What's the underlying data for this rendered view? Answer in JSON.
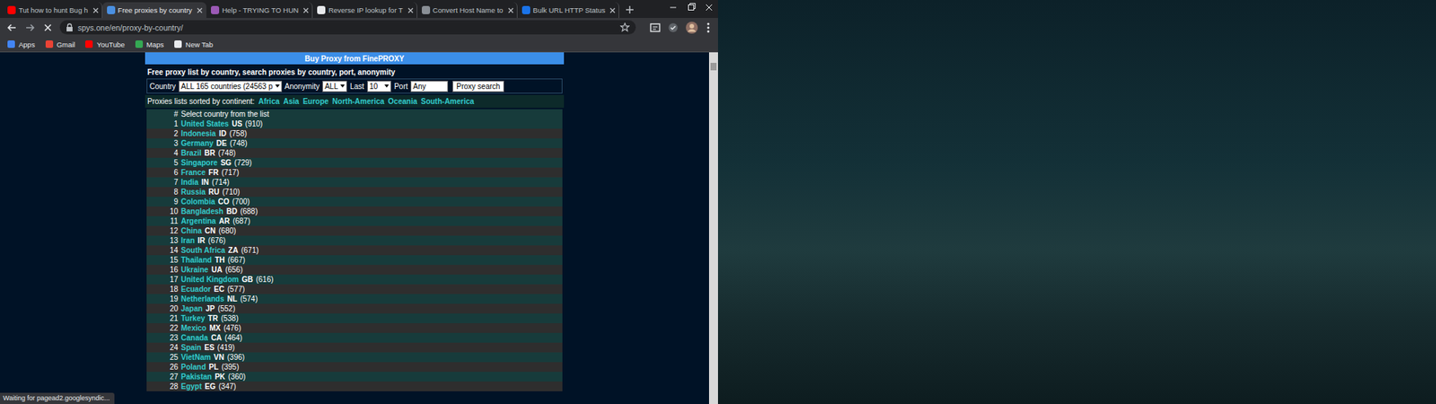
{
  "browser": {
    "tabs": [
      {
        "label": "Tut how to hunt Bug h",
        "selected": false,
        "color": "#ff0000"
      },
      {
        "label": "Free proxies by country",
        "selected": true,
        "color": "#4a90e2"
      },
      {
        "label": "Help - TRYING TO HUN",
        "selected": false,
        "color": "#9b59b6"
      },
      {
        "label": "Reverse IP lookup for T",
        "selected": false,
        "color": "#e8eaed"
      },
      {
        "label": "Convert Host Name to",
        "selected": false,
        "color": "#8a8f96"
      },
      {
        "label": "Bulk URL HTTP Status",
        "selected": false,
        "color": "#1a73e8"
      }
    ],
    "address_bar": {
      "url": "spys.one/en/proxy-by-country/"
    },
    "bookmarks": [
      {
        "label": "Apps",
        "color": "#4285f4"
      },
      {
        "label": "Gmail",
        "color": "#ea4335"
      },
      {
        "label": "YouTube",
        "color": "#ff0000"
      },
      {
        "label": "Maps",
        "color": "#34a853"
      },
      {
        "label": "New Tab",
        "color": "#e8eaed"
      }
    ],
    "status_bar": "Waiting for pagead2.googlesyndic..."
  },
  "page": {
    "banner": "Buy Proxy from FinePROXY",
    "heading": "Free proxy list by country, search proxies by country, port, anonymity",
    "filters": [
      {
        "label": "Country",
        "value": "ALL 165 countries (24563 p",
        "kind": "select"
      },
      {
        "label": "Anonymity",
        "value": "ALL",
        "kind": "select"
      },
      {
        "label": "Last",
        "value": "10",
        "kind": "select"
      },
      {
        "label": "Port",
        "value": "Any",
        "kind": "input"
      }
    ],
    "search_button": "Proxy search",
    "continents_label": "Proxies lists sorted by continent:",
    "continents": [
      "Africa",
      "Asia",
      "Europe",
      "North-America",
      "Oceania",
      "South-America"
    ],
    "list_header": {
      "number": "#",
      "text": "Select country from the list"
    },
    "countries": [
      {
        "rank": "1",
        "name": "United States",
        "code": "US",
        "count": "(910)"
      },
      {
        "rank": "2",
        "name": "Indonesia",
        "code": "ID",
        "count": "(758)"
      },
      {
        "rank": "3",
        "name": "Germany",
        "code": "DE",
        "count": "(748)"
      },
      {
        "rank": "4",
        "name": "Brazil",
        "code": "BR",
        "count": "(748)"
      },
      {
        "rank": "5",
        "name": "Singapore",
        "code": "SG",
        "count": "(729)"
      },
      {
        "rank": "6",
        "name": "France",
        "code": "FR",
        "count": "(717)"
      },
      {
        "rank": "7",
        "name": "India",
        "code": "IN",
        "count": "(714)"
      },
      {
        "rank": "8",
        "name": "Russia",
        "code": "RU",
        "count": "(710)"
      },
      {
        "rank": "9",
        "name": "Colombia",
        "code": "CO",
        "count": "(700)"
      },
      {
        "rank": "10",
        "name": "Bangladesh",
        "code": "BD",
        "count": "(688)"
      },
      {
        "rank": "11",
        "name": "Argentina",
        "code": "AR",
        "count": "(687)"
      },
      {
        "rank": "12",
        "name": "China",
        "code": "CN",
        "count": "(680)"
      },
      {
        "rank": "13",
        "name": "Iran",
        "code": "IR",
        "count": "(676)"
      },
      {
        "rank": "14",
        "name": "South Africa",
        "code": "ZA",
        "count": "(671)"
      },
      {
        "rank": "15",
        "name": "Thailand",
        "code": "TH",
        "count": "(667)"
      },
      {
        "rank": "16",
        "name": "Ukraine",
        "code": "UA",
        "count": "(656)"
      },
      {
        "rank": "17",
        "name": "United Kingdom",
        "code": "GB",
        "count": "(616)"
      },
      {
        "rank": "18",
        "name": "Ecuador",
        "code": "EC",
        "count": "(577)"
      },
      {
        "rank": "19",
        "name": "Netherlands",
        "code": "NL",
        "count": "(574)"
      },
      {
        "rank": "20",
        "name": "Japan",
        "code": "JP",
        "count": "(552)"
      },
      {
        "rank": "21",
        "name": "Turkey",
        "code": "TR",
        "count": "(538)"
      },
      {
        "rank": "22",
        "name": "Mexico",
        "code": "MX",
        "count": "(476)"
      },
      {
        "rank": "23",
        "name": "Canada",
        "code": "CA",
        "count": "(464)"
      },
      {
        "rank": "24",
        "name": "Spain",
        "code": "ES",
        "count": "(419)"
      },
      {
        "rank": "25",
        "name": "VietNam",
        "code": "VN",
        "count": "(396)"
      },
      {
        "rank": "26",
        "name": "Poland",
        "code": "PL",
        "count": "(395)"
      },
      {
        "rank": "27",
        "name": "Pakistan",
        "code": "PK",
        "count": "(360)"
      },
      {
        "rank": "28",
        "name": "Egypt",
        "code": "EG",
        "count": "(347)"
      }
    ]
  }
}
